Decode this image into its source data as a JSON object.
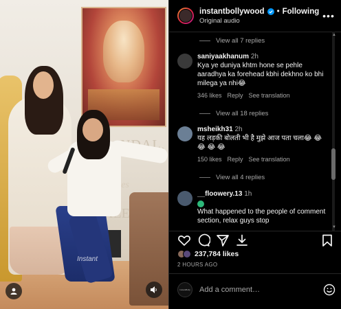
{
  "post": {
    "username": "instantbollywood",
    "follow_status": "Following",
    "audio": "Original audio",
    "watermark": "Instant",
    "poster_text_1": "NDAL,",
    "poster_text_2": "ves",
    "poster_text_3": "ALE"
  },
  "comments": {
    "view_replies_1": "View all 7 replies",
    "items": [
      {
        "user": "saniyaakhanum",
        "time": "2h",
        "text": "Kya ye duniya khtm hone se pehle aaradhya ka forehead kbhi dekhno ko bhi milega ya nhi😂",
        "likes": "346 likes",
        "reply": "Reply",
        "translate": "See translation",
        "avatar_color": "#3a3a3a"
      },
      {
        "user": "msheikh31",
        "time": "2h",
        "text": "यह लड़की बोलती भी है मुझे आज पता चला😂 😂 😂 😂 😂",
        "likes": "150 likes",
        "reply": "Reply",
        "translate": "See translation",
        "avatar_color": "#6b7f95"
      },
      {
        "user": "__floowery.13",
        "time": "1h",
        "text": "What happened to the people of comment section, relax guys stop",
        "avatar_color": "#4a5a6e"
      }
    ],
    "view_replies_2": "View all 18 replies",
    "view_replies_3": "View all 4 replies"
  },
  "actions": {
    "likes": "237,784 likes",
    "time_ago": "2 HOURS AGO",
    "add_comment_placeholder": "Add a comment…",
    "own_avatar_text": "InstantBolly"
  }
}
